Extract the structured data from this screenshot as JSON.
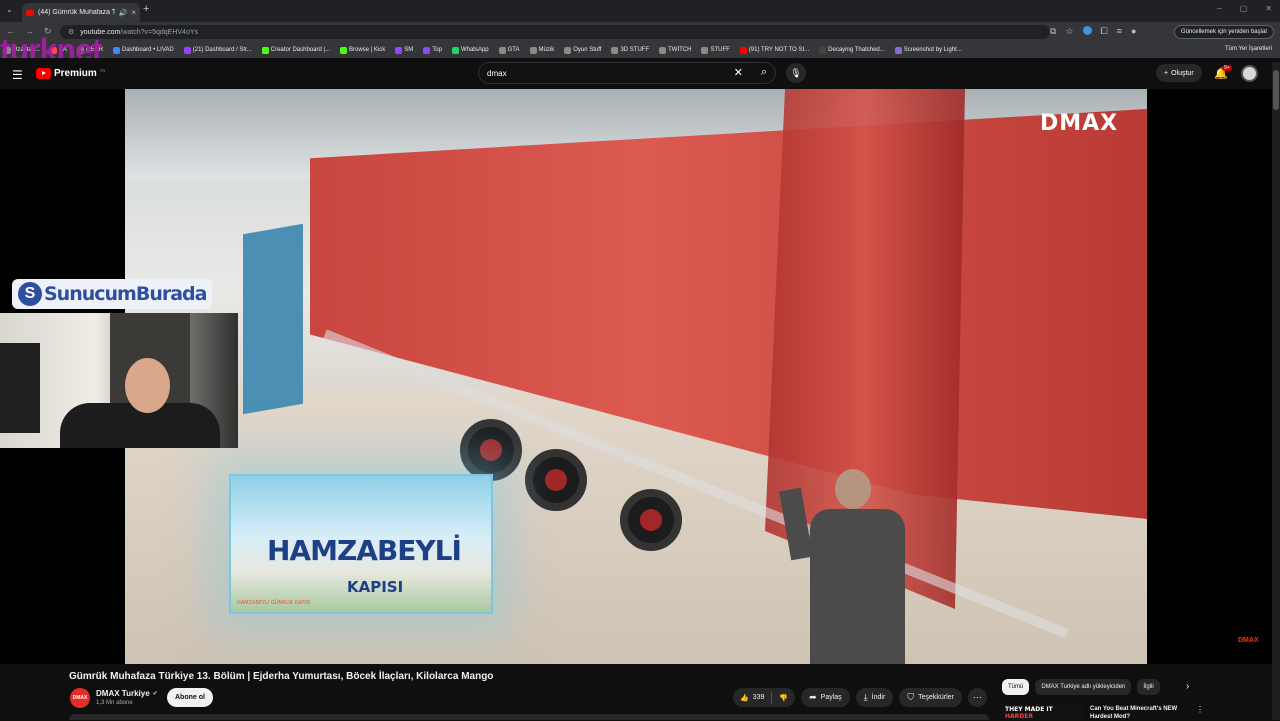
{
  "browser": {
    "tab_title": "(44) Gümrük Muhafaza Türk...",
    "new_tab": "+",
    "url_host": "youtube.com",
    "url_rest": "/watch?v=5qdqEHV4oYs",
    "update_label": "Güncellemek için yeniden başlat",
    "bookmarks": [
      {
        "label": "Uzaktan...",
        "color": "#888888"
      },
      {
        "label": "EA",
        "color": "#ff4747"
      },
      {
        "label": "GEAR",
        "color": "#888888"
      },
      {
        "label": "Dashboard • LIVAD",
        "color": "#4285f4"
      },
      {
        "label": "(21) Dashboard / Str...",
        "color": "#9146ff"
      },
      {
        "label": "Creator Dashboard |...",
        "color": "#53fc18"
      },
      {
        "label": "Browse | Kick",
        "color": "#53fc18"
      },
      {
        "label": "SM",
        "color": "#9146ff"
      },
      {
        "label": "Top",
        "color": "#9146ff"
      },
      {
        "label": "WhatsApp",
        "color": "#25d366"
      },
      {
        "label": "GTA",
        "color": "#8a8a8a"
      },
      {
        "label": "Müzik",
        "color": "#8a8a8a"
      },
      {
        "label": "Oyun Stuff",
        "color": "#8a8a8a"
      },
      {
        "label": "3D STUFF",
        "color": "#8a8a8a"
      },
      {
        "label": "TWITCH",
        "color": "#8a8a8a"
      },
      {
        "label": "STUFF",
        "color": "#8a8a8a"
      },
      {
        "label": "(91) TRY NOT TO SI...",
        "color": "#ff0000"
      },
      {
        "label": "Decaying Thatched...",
        "color": "#444444"
      },
      {
        "label": "Screenshot by Light...",
        "color": "#8a6bd6"
      }
    ],
    "all_bookmarks": "Tüm Yer İşaretleri",
    "overlay_brand": "turknet"
  },
  "youtube": {
    "logo_text": "Premium",
    "logo_region": "TR",
    "search_value": "dmax",
    "create_label": "Oluştur",
    "notif_badge": "9+"
  },
  "video": {
    "channel_watermark": "DMAX",
    "lower_third_title": "HAMZABEYLİ",
    "lower_third_sub": "KAPISI",
    "lower_third_caption": "HAMZABEYLİ GÜMRÜK KAPISI",
    "corner_logo": "DMAX",
    "streamer_banner": "SunucumBurada",
    "streamer_banner_icon": "S"
  },
  "meta": {
    "title": "Gümrük Muhafaza Türkiye 13. Bölüm | Ejderha Yumurtası, Böcek İlaçları, Kilolarca Mango",
    "channel_name": "DMAX Turkiye",
    "channel_avatar_text": "DMAX",
    "subscribers": "1,3 Mn abone",
    "subscribe_label": "Abone ol",
    "likes": "339",
    "share_label": "Paylaş",
    "download_label": "İndir",
    "thanks_label": "Teşekkürler"
  },
  "sidebar": {
    "chips": [
      "Tümü",
      "DMAX Turkiye adlı yükleyiciden",
      "İlgili"
    ],
    "rec_thumb_text_1": "THEY MADE IT",
    "rec_thumb_text_2": "HARDER",
    "rec_title": "Can You Beat Minecraft's NEW Hardest Mod?"
  }
}
